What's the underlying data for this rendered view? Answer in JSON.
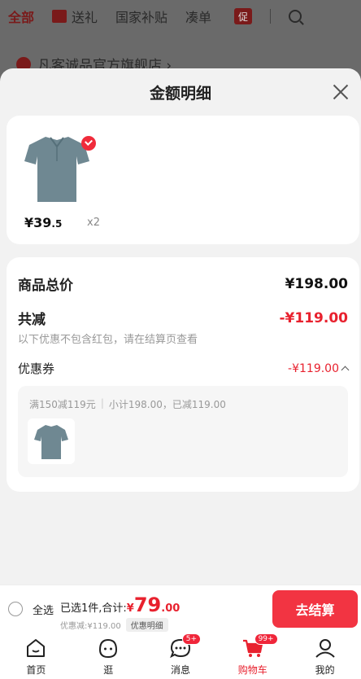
{
  "topbar": {
    "tab_all": "全部",
    "tab_gift": "送礼",
    "tab_subsidy": "国家补贴",
    "tab_bundle": "凑单",
    "promo": "促"
  },
  "shop": {
    "name": "凡客诚品官方旗舰店 ›"
  },
  "sheet": {
    "title": "金额明细",
    "product": {
      "price_main": "¥39",
      "price_dec": ".5",
      "qty": "x2"
    },
    "total_label": "商品总价",
    "total_value": "¥198.00",
    "reduce_label": "共减",
    "reduce_value": "-¥119.00",
    "note": "以下优惠不包含红包，请在结算页查看",
    "coupon_label": "优惠券",
    "coupon_value": "-¥119.00",
    "coupon_rule": "满150减119元",
    "coupon_sep": "|",
    "coupon_sub": "小计198.00，已减119.00"
  },
  "checkout": {
    "select_all": "全选",
    "selected": "已选1件,合计:",
    "yen": "¥",
    "amount_int": "79",
    "amount_dec": ".00",
    "discount": "优惠减:¥119.00",
    "detail": "优惠明细",
    "pay": "去结算"
  },
  "tabbar": {
    "items": [
      {
        "label": "首页"
      },
      {
        "label": "逛"
      },
      {
        "label": "消息",
        "badge": "5+"
      },
      {
        "label": "购物车",
        "badge": "99+"
      },
      {
        "label": "我的"
      }
    ]
  },
  "colors": {
    "accent": "#e8212e",
    "button": "#f23442"
  }
}
